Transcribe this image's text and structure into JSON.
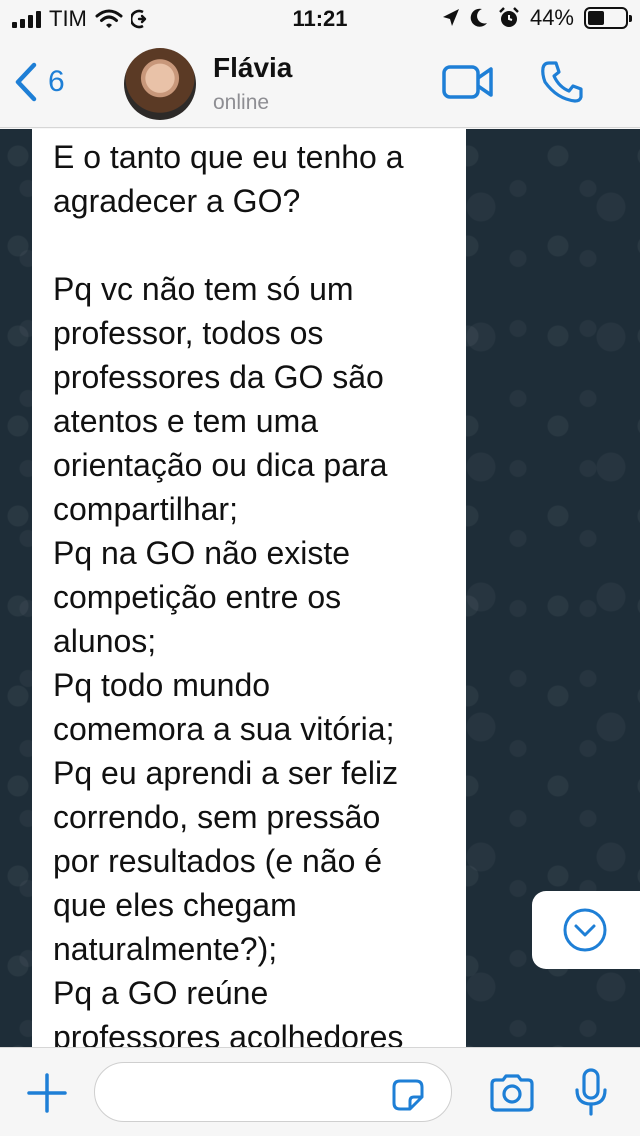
{
  "status_bar": {
    "carrier": "TIM",
    "time": "11:21",
    "battery_percent": "44%",
    "battery_level": 0.44,
    "icons": [
      "signal-icon",
      "wifi-icon",
      "sync-icon",
      "location-icon",
      "moon-icon",
      "alarm-icon",
      "battery-icon"
    ]
  },
  "header": {
    "back_count": "6",
    "contact_name": "Flávia",
    "contact_status": "online",
    "icons": [
      "back-chevron-icon",
      "video-call-icon",
      "phone-icon"
    ]
  },
  "message": {
    "lines": [
      "E o tanto que eu tenho a",
      "agradecer a GO?",
      "",
      "Pq vc não tem só um",
      "professor, todos os",
      "professores da GO são",
      "atentos e tem uma",
      "orientação ou dica para",
      "compartilhar;",
      "Pq na GO não existe",
      "competição entre os",
      "alunos;",
      "Pq todo mundo",
      "comemora a sua vitória;",
      "Pq eu aprendi a ser feliz",
      "correndo, sem pressão",
      "por resultados (e não é",
      "que eles chegam",
      "naturalmente?);",
      "Pq a GO reúne",
      "professores acolhedores"
    ]
  },
  "composer": {
    "input_value": "",
    "icons": [
      "plus-icon",
      "sticker-icon",
      "camera-icon",
      "microphone-icon"
    ]
  },
  "colors": {
    "accent": "#1e7fd6",
    "chat_background": "#1e2d38",
    "bubble": "#ffffff",
    "bar_background": "#f6f6f6"
  }
}
